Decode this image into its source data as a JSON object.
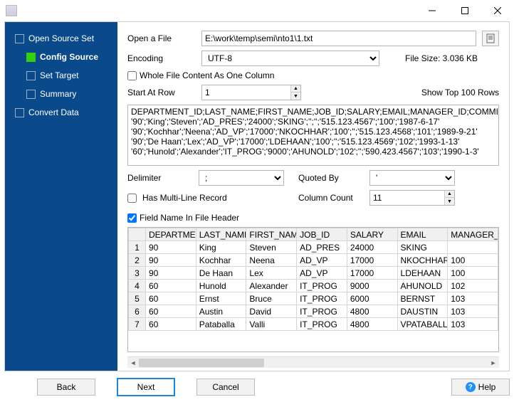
{
  "sidebar": [
    {
      "label": "Open Source Set",
      "active": false
    },
    {
      "label": "Config Source",
      "active": true,
      "child": true
    },
    {
      "label": "Set Target",
      "active": false,
      "child": true
    },
    {
      "label": "Summary",
      "active": false,
      "child": true
    },
    {
      "label": "Convert Data",
      "active": false
    }
  ],
  "form": {
    "open_file_label": "Open a File",
    "file_path": "E:\\work\\temp\\semi\\nto1\\1.txt",
    "encoding_label": "Encoding",
    "encoding_value": "UTF-8",
    "file_size_label": "File Size: 3.036 KB",
    "whole_file_label": "Whole File Content As One Column",
    "start_row_label": "Start At Row",
    "start_row_value": "1",
    "show_top_label": "Show Top 100 Rows",
    "delimiter_label": "Delimiter",
    "delimiter_value": ";",
    "quoted_label": "Quoted By",
    "quoted_value": "'",
    "multiline_label": "Has Multi-Line Record",
    "colcount_label": "Column Count",
    "colcount_value": "11",
    "header_label": "Field Name In File Header"
  },
  "preview_lines": [
    "DEPARTMENT_ID;LAST_NAME;FIRST_NAME;JOB_ID;SALARY;EMAIL;MANAGER_ID;COMMISSION_",
    "'90';'King';'Steven';'AD_PRES';'24000';'SKING';'';'';'515.123.4567';'100';'1987-6-17'",
    "'90';'Kochhar';'Neena';'AD_VP';'17000';'NKOCHHAR';'100';'';'515.123.4568';'101';'1989-9-21'",
    "'90';'De Haan';'Lex';'AD_VP';'17000';'LDEHAAN';'100';'';'515.123.4569';'102';'1993-1-13'",
    "'60';'Hunold';'Alexander';'IT_PROG';'9000';'AHUNOLD';'102';'';'590.423.4567';'103';'1990-1-3'"
  ],
  "columns": [
    "DEPARTMENT_ID",
    "LAST_NAME",
    "FIRST_NAME",
    "JOB_ID",
    "SALARY",
    "EMAIL",
    "MANAGER_ID"
  ],
  "rows": [
    [
      "90",
      "King",
      "Steven",
      "AD_PRES",
      "24000",
      "SKING",
      ""
    ],
    [
      "90",
      "Kochhar",
      "Neena",
      "AD_VP",
      "17000",
      "NKOCHHAR",
      "100"
    ],
    [
      "90",
      "De Haan",
      "Lex",
      "AD_VP",
      "17000",
      "LDEHAAN",
      "100"
    ],
    [
      "60",
      "Hunold",
      "Alexander",
      "IT_PROG",
      "9000",
      "AHUNOLD",
      "102"
    ],
    [
      "60",
      "Ernst",
      "Bruce",
      "IT_PROG",
      "6000",
      "BERNST",
      "103"
    ],
    [
      "60",
      "Austin",
      "David",
      "IT_PROG",
      "4800",
      "DAUSTIN",
      "103"
    ],
    [
      "60",
      "Pataballa",
      "Valli",
      "IT_PROG",
      "4800",
      "VPATABALLA",
      "103"
    ]
  ],
  "buttons": {
    "back": "Back",
    "next": "Next",
    "cancel": "Cancel",
    "help": "Help"
  }
}
